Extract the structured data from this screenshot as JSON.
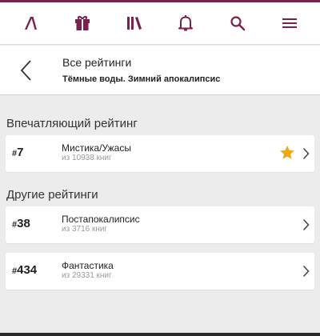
{
  "colors": {
    "accent": "#7a1f4e",
    "star": "#f2a60f",
    "icon": "#7a1f4e"
  },
  "nav": {
    "items": [
      {
        "icon": "app-logo-icon"
      },
      {
        "icon": "gift-icon"
      },
      {
        "icon": "library-icon"
      },
      {
        "icon": "bell-icon"
      },
      {
        "icon": "search-icon"
      },
      {
        "icon": "menu-icon"
      }
    ]
  },
  "header": {
    "title": "Все рейтинги",
    "subtitle": "Тёмные воды. Зимний апокалипсис"
  },
  "sections": [
    {
      "title": "Впечатляющий рейтинг",
      "items": [
        {
          "rank_hash": "#",
          "rank": "7",
          "title": "Мистика/Ужасы",
          "meta": "из 10938 книг",
          "starred": true
        }
      ]
    },
    {
      "title": "Другие рейтинги",
      "items": [
        {
          "rank_hash": "#",
          "rank": "38",
          "title": "Постапокалипсис",
          "meta": "из 3716 книг",
          "starred": false
        },
        {
          "rank_hash": "#",
          "rank": "434",
          "title": "Фантастика",
          "meta": "из 29331 книг",
          "starred": false
        }
      ]
    }
  ]
}
